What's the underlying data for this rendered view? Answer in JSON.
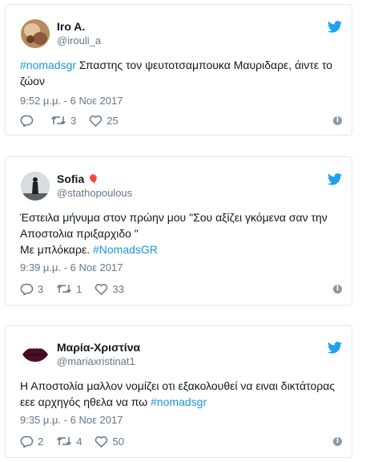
{
  "tweets": [
    {
      "name": "Iro A.",
      "handle": "@irouli_a",
      "text_prefix": "",
      "hashtag": "#nomadsgr",
      "text": " Σπαστης τον ψευτοτσαμπουκα Μαυριδαρε, άιντε το ζώον",
      "time": "9:52 μ.μ. - 6 Νοε 2017",
      "replies": "",
      "retweets": "3",
      "likes": "25",
      "avatar_icon": "profile-photo"
    },
    {
      "name": "Sofia",
      "name_emoji": "🎈",
      "handle": "@stathopoulous",
      "text_line1": "Έστειλα μήνυμα στον πρώην μου \"Σου αξίζει γκόμενα σαν την Αποστολια πριξαρχιδο \"",
      "text_line2": "Με μπλόκαρε. ",
      "hashtag": "#NomadsGR",
      "time": "9:39 μ.μ. - 6 Νοε 2017",
      "replies": "3",
      "retweets": "1",
      "likes": "33",
      "avatar_icon": "silhouette-photo"
    },
    {
      "name": "Μαρία-Χριστίνα",
      "handle": "@mariaxristinat1",
      "text": "Η Αποστολία μαλλον νομίζει οτι εξακολουθεί να ειναι δικτάτορας εεε αρχηγός ηθελα να πω ",
      "hashtag": "#nomadsgr",
      "time": "9:35 μ.μ. - 6 Νοε 2017",
      "replies": "2",
      "retweets": "4",
      "likes": "50",
      "avatar_icon": "lips-photo"
    }
  ],
  "colors": {
    "link": "#1b95e0",
    "muted": "#657786",
    "border": "#e1e8ed",
    "twitter_blue": "#1da1f2"
  },
  "icons": [
    "reply-icon",
    "retweet-icon",
    "like-icon",
    "info-icon",
    "twitter-bird-icon"
  ]
}
